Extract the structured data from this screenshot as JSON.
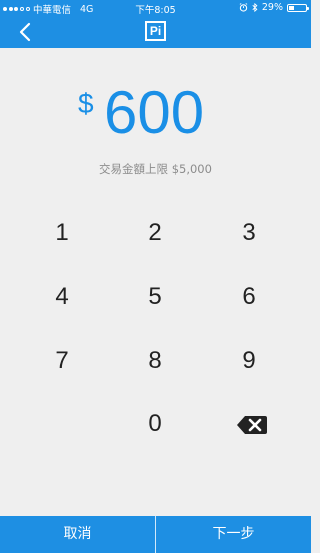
{
  "status_bar": {
    "carrier": "中華電信",
    "network": "4G",
    "time": "下午8:05",
    "battery_percent": "29%",
    "battery_level": 0.29
  },
  "nav": {
    "back_icon": "chevron-left-icon",
    "logo_text": "Pi"
  },
  "amount": {
    "currency_symbol": "$",
    "value": "600"
  },
  "limit_text": "交易金額上限 $5,000",
  "keypad": {
    "keys": [
      "1",
      "2",
      "3",
      "4",
      "5",
      "6",
      "7",
      "8",
      "9",
      "0"
    ],
    "backspace_icon": "backspace-icon"
  },
  "buttons": {
    "cancel": "取消",
    "next": "下一步"
  },
  "colors": {
    "primary": "#1e8fe3",
    "amount": "#1a8fe6",
    "background": "#efefef"
  }
}
